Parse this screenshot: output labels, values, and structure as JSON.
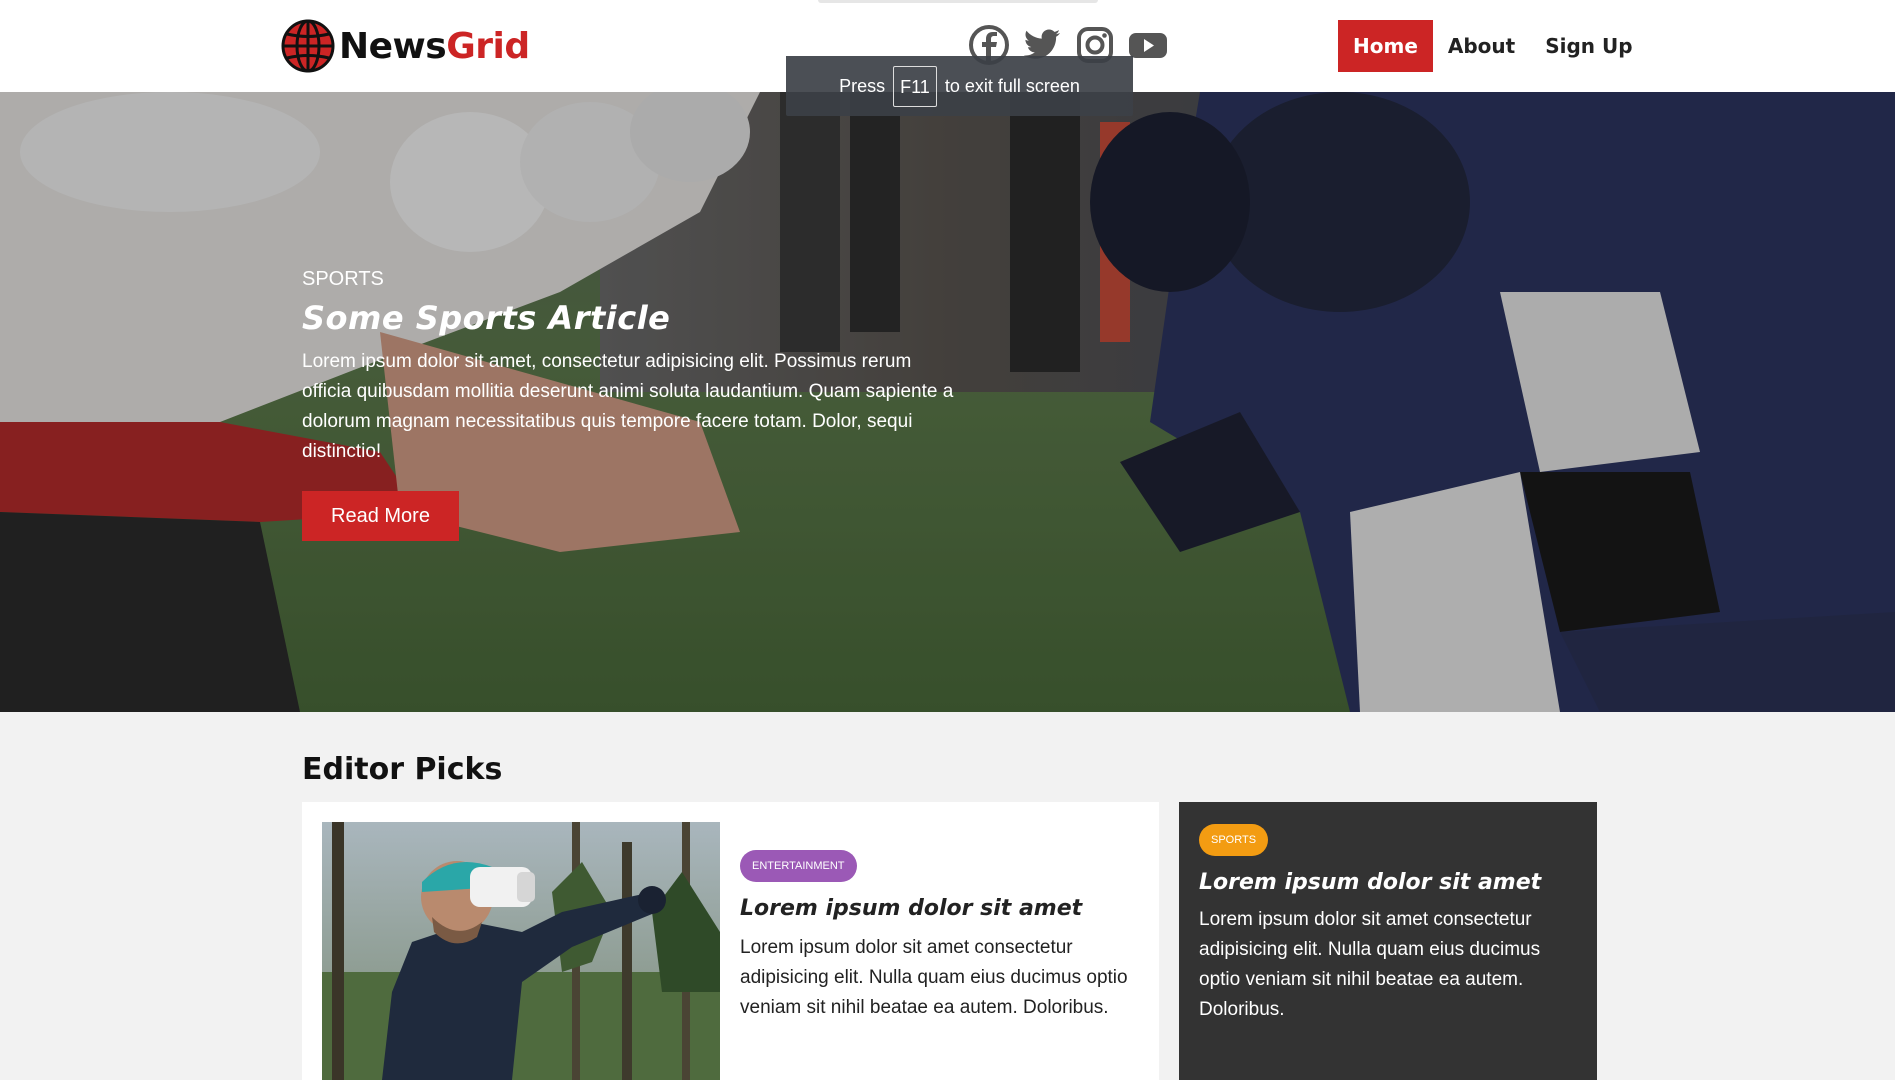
{
  "logo": {
    "part1": "News",
    "part2": "Grid"
  },
  "social": [
    "facebook-icon",
    "twitter-icon",
    "instagram-icon",
    "youtube-icon"
  ],
  "nav": {
    "home": "Home",
    "about": "About",
    "signup": "Sign Up"
  },
  "fullscreen_notice": {
    "press": "Press",
    "key": "F11",
    "rest": "to exit full screen"
  },
  "hero": {
    "category": "SPORTS",
    "title": "Some Sports Article",
    "text": "Lorem ipsum dolor sit amet, consectetur adipisicing elit. Possimus rerum officia quibusdam mollitia deserunt animi soluta laudantium. Quam sapiente a dolorum magnam necessitatibus quis tempore facere totam. Dolor, sequi distinctio!",
    "button": "Read More"
  },
  "editor_picks": {
    "heading": "Editor Picks",
    "main_card": {
      "badge": "ENTERTAINMENT",
      "title": "Lorem ipsum dolor sit amet",
      "text": "Lorem ipsum dolor sit amet consectetur adipisicing elit. Nulla quam eius ducimus optio veniam sit nihil beatae ea autem. Doloribus."
    },
    "side_card": {
      "badge": "SPORTS",
      "title": "Lorem ipsum dolor sit amet",
      "text": "Lorem ipsum dolor sit amet consectetur adipisicing elit. Nulla quam eius ducimus optio veniam sit nihil beatae ea autem. Doloribus."
    }
  },
  "colors": {
    "brand_red": "#cc2525",
    "entertainment": "#9b59b6",
    "sports": "#f39c12",
    "dark_card": "#333333"
  }
}
